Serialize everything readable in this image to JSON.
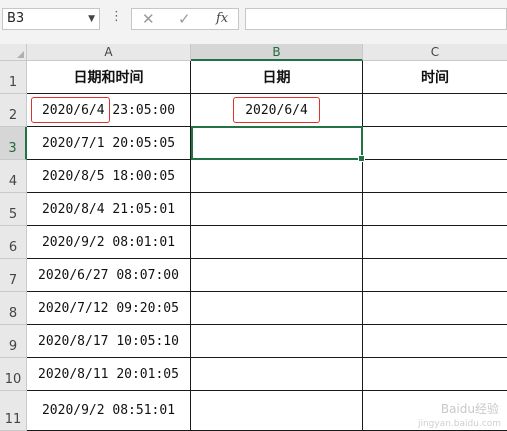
{
  "name_box": "B3",
  "formula_bar": {
    "cancel_icon": "✕",
    "enter_icon": "✓",
    "fx_label": "fx",
    "value": ""
  },
  "columns": [
    "A",
    "B",
    "C"
  ],
  "rows": [
    "1",
    "2",
    "3",
    "4",
    "5",
    "6",
    "7",
    "8",
    "9",
    "10",
    "11"
  ],
  "headers": {
    "a": "日期和时间",
    "b": "日期",
    "c": "时间"
  },
  "data": [
    {
      "a": "2020/6/4  23:05:00",
      "b": "2020/6/4",
      "c": ""
    },
    {
      "a": "2020/7/1  20:05:05",
      "b": "",
      "c": ""
    },
    {
      "a": "2020/8/5  18:00:05",
      "b": "",
      "c": ""
    },
    {
      "a": "2020/8/4  21:05:01",
      "b": "",
      "c": ""
    },
    {
      "a": "2020/9/2  08:01:01",
      "b": "",
      "c": ""
    },
    {
      "a": "2020/6/27  08:07:00",
      "b": "",
      "c": ""
    },
    {
      "a": "2020/7/12  09:20:05",
      "b": "",
      "c": ""
    },
    {
      "a": "2020/8/17  10:05:10",
      "b": "",
      "c": ""
    },
    {
      "a": "2020/8/11  20:01:05",
      "b": "",
      "c": ""
    },
    {
      "a": "2020/9/2  08:51:01",
      "b": "",
      "c": ""
    }
  ],
  "selected_cell": "B3",
  "colors": {
    "accent": "#217346",
    "highlight": "#e0312c"
  },
  "watermark": {
    "main": "Baidu经验",
    "sub": "jingyan.baidu.com"
  }
}
